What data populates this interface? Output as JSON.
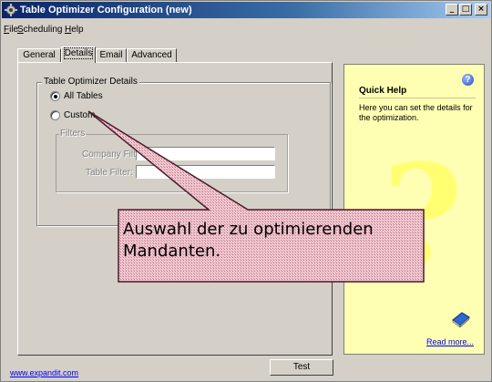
{
  "window": {
    "title": "Table Optimizer Configuration (new)",
    "controls": {
      "minimize": "_",
      "maximize": "□",
      "close": "×"
    }
  },
  "menu": [
    {
      "label": "File"
    },
    {
      "label": "Scheduling"
    },
    {
      "label": "Help"
    }
  ],
  "tabs": [
    {
      "label": "General",
      "active": false
    },
    {
      "label": "Details",
      "active": true
    },
    {
      "label": "Email",
      "active": false
    },
    {
      "label": "Advanced",
      "active": false
    }
  ],
  "details": {
    "group_title": "Table Optimizer Details",
    "options": [
      {
        "label": "All Tables",
        "checked": true
      },
      {
        "label": "Custom",
        "checked": false
      }
    ],
    "filters": {
      "title": "Filters",
      "company_filter": {
        "label": "Company Filter:",
        "value": ""
      },
      "table_filter": {
        "label": "Table Filter:",
        "value": ""
      }
    }
  },
  "help": {
    "title": "Quick Help",
    "text": "Here you can set the details for the optimization.",
    "read_more": "Read more...",
    "icon": "help-circle-icon",
    "book_icon": "book-icon"
  },
  "footer": {
    "link": "www.expandit.com",
    "test_button": "Test"
  },
  "annotation": {
    "text": "Auswahl der zu optimierenden Mandanten."
  },
  "colors": {
    "title_bar": "#0a246a",
    "window_bg": "#d4d0c8",
    "help_bg": "#ffffb4",
    "callout_fill": "#e8b4c0",
    "callout_border": "#4a1a2a"
  }
}
